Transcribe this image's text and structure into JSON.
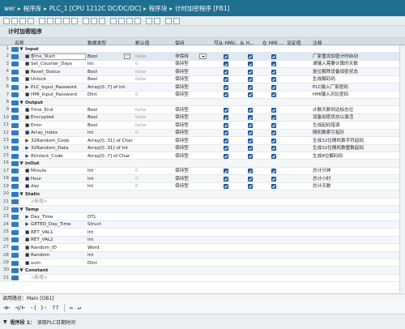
{
  "breadcrumb": [
    "wer",
    "程序库",
    "PLC_1 [CPU 1212C DC/DC/DC]",
    "程序块",
    "计时加密程序 [FB1]"
  ],
  "block_title": "计时加密程序",
  "columns": [
    "名称",
    "数据类型",
    "默认值",
    "保持",
    "可从 HMI/...",
    "从 H...",
    "在 HMI ...",
    "设定值",
    "注释"
  ],
  "rows": [
    {
      "n": "1",
      "ind": 0,
      "dir": "in",
      "exp": "▼",
      "name": "Input",
      "type": "",
      "dval": "",
      "retain": "",
      "h1": false,
      "h2": false,
      "h3": false,
      "comment": "",
      "section": true
    },
    {
      "n": "2",
      "ind": 1,
      "dir": "in",
      "exp": "■",
      "name": "Time_Start",
      "type": "Bool",
      "dval": "false",
      "retain": "非保持",
      "h1": true,
      "h2": true,
      "h3": true,
      "comment": "厂家重设加密计时启动",
      "sel": true
    },
    {
      "n": "3",
      "ind": 1,
      "dir": "in",
      "exp": "■",
      "name": "Set_Counter_Days",
      "type": "Int",
      "dval": "0",
      "retain": "保持型",
      "h1": true,
      "h2": true,
      "h3": true,
      "comment": "请输入需要计算的天数"
    },
    {
      "n": "4",
      "ind": 1,
      "dir": "in",
      "exp": "■",
      "name": "Reset_Status",
      "type": "Bool",
      "dval": "false",
      "retain": "保持型",
      "h1": true,
      "h2": true,
      "h3": true,
      "comment": "复位解除设备加密状态"
    },
    {
      "n": "5",
      "ind": 1,
      "dir": "in",
      "exp": "■",
      "name": "Unlock",
      "type": "Bool",
      "dval": "false",
      "retain": "保持型",
      "h1": true,
      "h2": true,
      "h3": true,
      "comment": "生成解码码"
    },
    {
      "n": "6",
      "ind": 1,
      "dir": "in",
      "exp": "▶",
      "name": "PLC_Input_Password",
      "type": "Array[0..7] of Int",
      "dval": "",
      "retain": "保持型",
      "h1": true,
      "h2": true,
      "h3": true,
      "comment": "PLC输入厂家密码"
    },
    {
      "n": "7",
      "ind": 1,
      "dir": "in",
      "exp": "■",
      "name": "HMI_Input_Password",
      "type": "DInt",
      "dval": "0",
      "retain": "保持型",
      "h1": true,
      "h2": true,
      "h3": true,
      "comment": "HMI输入对比密码"
    },
    {
      "n": "8",
      "ind": 0,
      "dir": "out",
      "exp": "▼",
      "name": "Output",
      "type": "",
      "dval": "",
      "retain": "",
      "h1": false,
      "h2": false,
      "h3": false,
      "comment": "",
      "section": true
    },
    {
      "n": "9",
      "ind": 1,
      "dir": "out",
      "exp": "■",
      "name": "Time_End",
      "type": "Bool",
      "dval": "false",
      "retain": "保持型",
      "h1": true,
      "h2": true,
      "h3": true,
      "comment": "计数天数到达标志位"
    },
    {
      "n": "10",
      "ind": 1,
      "dir": "out",
      "exp": "■",
      "name": "Encrypted",
      "type": "Bool",
      "dval": "false",
      "retain": "保持型",
      "h1": true,
      "h2": true,
      "h3": true,
      "comment": "设备加密状态以激活"
    },
    {
      "n": "11",
      "ind": 1,
      "dir": "out",
      "exp": "■",
      "name": "Error",
      "type": "Bool",
      "dval": "false",
      "retain": "保持型",
      "h1": true,
      "h2": true,
      "h3": true,
      "comment": "生成起码错误"
    },
    {
      "n": "12",
      "ind": 1,
      "dir": "out",
      "exp": "■",
      "name": "Array_Index",
      "type": "Int",
      "dval": "0",
      "retain": "保持型",
      "h1": true,
      "h2": true,
      "h3": true,
      "comment": "随机数索引指针"
    },
    {
      "n": "13",
      "ind": 1,
      "dir": "out",
      "exp": "▶",
      "name": "32Random_Code",
      "type": "Array[0..31] of Char",
      "dval": "",
      "retain": "保持型",
      "h1": true,
      "h2": true,
      "h3": true,
      "comment": "生成32位随机数字符起码"
    },
    {
      "n": "14",
      "ind": 1,
      "dir": "out",
      "exp": "▶",
      "name": "32Random_Data",
      "type": "Array[0..31] of Int",
      "dval": "",
      "retain": "保持型",
      "h1": true,
      "h2": true,
      "h3": true,
      "comment": "生成32位随机数整数起码"
    },
    {
      "n": "15",
      "ind": 1,
      "dir": "out",
      "exp": "▶",
      "name": "8Unlock_Code",
      "type": "Array[0..7] of Char",
      "dval": "",
      "retain": "保持型",
      "h1": true,
      "h2": true,
      "h3": true,
      "comment": "生成8位解码码"
    },
    {
      "n": "16",
      "ind": 0,
      "dir": "inout",
      "exp": "▼",
      "name": "InOut",
      "type": "",
      "dval": "",
      "retain": "",
      "h1": false,
      "h2": false,
      "h3": false,
      "comment": "",
      "section": true
    },
    {
      "n": "17",
      "ind": 1,
      "dir": "inout",
      "exp": "■",
      "name": "Minute",
      "type": "Int",
      "dval": "0",
      "retain": "保持型",
      "h1": true,
      "h2": true,
      "h3": true,
      "comment": "总计分钟"
    },
    {
      "n": "18",
      "ind": 1,
      "dir": "inout",
      "exp": "■",
      "name": "Hour",
      "type": "Int",
      "dval": "0",
      "retain": "保持型",
      "h1": true,
      "h2": true,
      "h3": true,
      "comment": "总计小时"
    },
    {
      "n": "19",
      "ind": 1,
      "dir": "inout",
      "exp": "■",
      "name": "day",
      "type": "Int",
      "dval": "0",
      "retain": "保持型",
      "h1": true,
      "h2": true,
      "h3": true,
      "comment": "总计天数"
    },
    {
      "n": "20",
      "ind": 0,
      "dir": "static",
      "exp": "▼",
      "name": "Static",
      "type": "",
      "dval": "",
      "retain": "",
      "h1": false,
      "h2": false,
      "h3": false,
      "comment": "",
      "section": true
    },
    {
      "n": "21",
      "ind": 1,
      "dir": "static",
      "exp": "",
      "name": "<新增>",
      "type": "",
      "dval": "",
      "retain": "",
      "h1": false,
      "h2": false,
      "h3": false,
      "comment": "",
      "add": true
    },
    {
      "n": "22",
      "ind": 0,
      "dir": "temp",
      "exp": "▼",
      "name": "Temp",
      "type": "",
      "dval": "",
      "retain": "",
      "h1": false,
      "h2": false,
      "h3": false,
      "comment": "",
      "section": true
    },
    {
      "n": "23",
      "ind": 1,
      "dir": "temp",
      "exp": "▶",
      "name": "Day_Time",
      "type": "DTL",
      "dval": "",
      "retain": "",
      "h1": false,
      "h2": false,
      "h3": false,
      "comment": ""
    },
    {
      "n": "24",
      "ind": 1,
      "dir": "temp",
      "exp": "▶",
      "name": "GETED_Day_Time",
      "type": "Struct",
      "dval": "",
      "retain": "",
      "h1": false,
      "h2": false,
      "h3": false,
      "comment": ""
    },
    {
      "n": "25",
      "ind": 1,
      "dir": "temp",
      "exp": "■",
      "name": "RET_VAL1",
      "type": "Int",
      "dval": "",
      "retain": "",
      "h1": false,
      "h2": false,
      "h3": false,
      "comment": ""
    },
    {
      "n": "26",
      "ind": 1,
      "dir": "temp",
      "exp": "■",
      "name": "RET_VAL2",
      "type": "Int",
      "dval": "",
      "retain": "",
      "h1": false,
      "h2": false,
      "h3": false,
      "comment": ""
    },
    {
      "n": "27",
      "ind": 1,
      "dir": "temp",
      "exp": "■",
      "name": "Random_ID",
      "type": "Word",
      "dval": "",
      "retain": "",
      "h1": false,
      "h2": false,
      "h3": false,
      "comment": ""
    },
    {
      "n": "28",
      "ind": 1,
      "dir": "temp",
      "exp": "■",
      "name": "Random",
      "type": "Int",
      "dval": "",
      "retain": "",
      "h1": false,
      "h2": false,
      "h3": false,
      "comment": ""
    },
    {
      "n": "29",
      "ind": 1,
      "dir": "temp",
      "exp": "■",
      "name": "sum",
      "type": "DInt",
      "dval": "",
      "retain": "",
      "h1": false,
      "h2": false,
      "h3": false,
      "comment": ""
    },
    {
      "n": "30",
      "ind": 0,
      "dir": "const",
      "exp": "▼",
      "name": "Constant",
      "type": "",
      "dval": "",
      "retain": "",
      "h1": false,
      "h2": false,
      "h3": false,
      "comment": "",
      "section": true
    },
    {
      "n": "31",
      "ind": 1,
      "dir": "const",
      "exp": "",
      "name": "<新增>",
      "type": "",
      "dval": "",
      "retain": "",
      "h1": false,
      "h2": false,
      "h3": false,
      "comment": "",
      "add": true
    }
  ],
  "call_path": "调用路径：Main [OB1]",
  "toolbar_items": [
    "⊣⊢",
    "⊣/⊢",
    "-( )-",
    "??",
    "↦",
    "↵"
  ],
  "network": {
    "label": "程序段 1：",
    "title": "读取PLC日期时间"
  },
  "colors": {
    "title_bar": "#1f6f8f",
    "dir_in": "#2e7bc5",
    "dir_out": "#2e7bc5",
    "checkbox": "#2466b4"
  }
}
